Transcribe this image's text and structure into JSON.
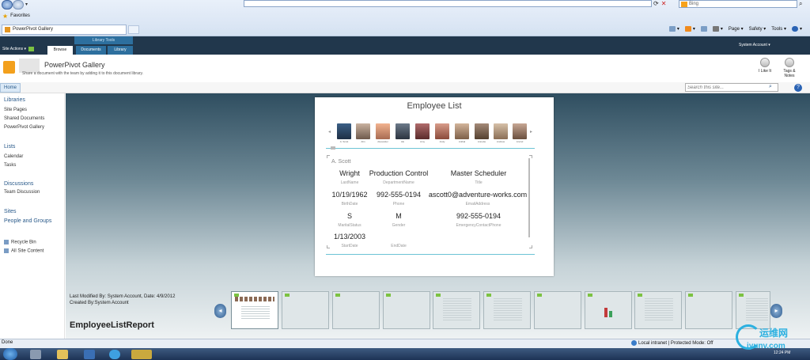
{
  "browser": {
    "search_text": "Bing",
    "favorites_label": "Favorites",
    "tab_title": "PowerPivot Gallery",
    "commands": [
      "Page ▾",
      "Safety ▾",
      "Tools ▾"
    ],
    "status": "Done",
    "zone": "Local intranet | Protected Mode: Off",
    "clock": "12:24 PM"
  },
  "ribbon": {
    "site_actions": "Site Actions ▾",
    "context_group": "Library Tools",
    "tabs": [
      "Browse",
      "Documents",
      "Library"
    ],
    "account": "System Account ▾"
  },
  "title_area": {
    "title": "PowerPivot Gallery",
    "description": "Share a document with the team by adding it to this document library.",
    "ilike": "I Like It",
    "tags": "Tags & Notes"
  },
  "nav": {
    "home": "Home",
    "search_placeholder": "Search this site..."
  },
  "quick_launch": {
    "libraries": "Libraries",
    "site_pages": "Site Pages",
    "shared_documents": "Shared Documents",
    "powerpivot_gallery": "PowerPivot Gallery",
    "lists": "Lists",
    "calendar": "Calendar",
    "tasks": "Tasks",
    "discussions": "Discussions",
    "team_discussion": "Team Discussion",
    "sites": "Sites",
    "people_groups": "People and Groups",
    "recycle_bin": "Recycle Bin",
    "all_site_content": "All Site Content"
  },
  "report": {
    "title": "Employee List",
    "selected": "A. Scott",
    "avatars": [
      "A. Scott",
      "Ahn",
      "Alexander",
      "Alu",
      "Amy",
      "Andy",
      "Anibal",
      "Annette",
      "Andrew",
      "Arvind"
    ],
    "fields": [
      {
        "value": "Wright",
        "label": "LastName"
      },
      {
        "value": "Production Control",
        "label": "DepartmentName"
      },
      {
        "value": "Master Scheduler",
        "label": "Title"
      },
      {
        "value": "10/19/1962",
        "label": "BirthDate"
      },
      {
        "value": "992-555-0194",
        "label": "Phone"
      },
      {
        "value": "ascott0@adventure-works.com",
        "label": "EmailAddress"
      },
      {
        "value": "S",
        "label": "MaritalStatus"
      },
      {
        "value": "M",
        "label": "Gender"
      },
      {
        "value": "992-555-0194",
        "label": "EmergencyContactPhone"
      },
      {
        "value": "1/13/2003",
        "label": "StartDate"
      },
      {
        "value": "",
        "label": "EndDate"
      }
    ]
  },
  "meta": {
    "modified": "Last Modified By: System Account,  Date: 4/9/2012",
    "created": "Created By:System Account",
    "report_name": "EmployeeListReport"
  },
  "watermark": {
    "text": "运维网",
    "url": "iyunv.com"
  }
}
